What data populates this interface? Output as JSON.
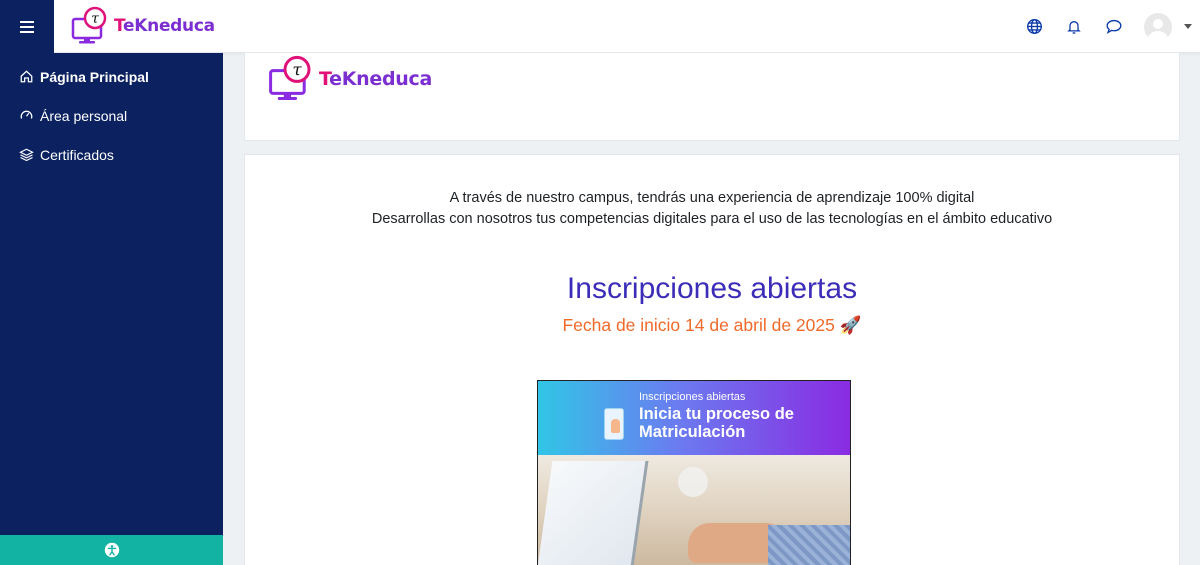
{
  "brand": {
    "prefix": "T",
    "name": "eKneduca",
    "logo_letter": "τ"
  },
  "sidebar": {
    "items": [
      {
        "label": "Página Principal",
        "icon": "home-icon",
        "active": true
      },
      {
        "label": "Área personal",
        "icon": "dashboard-icon",
        "active": false
      },
      {
        "label": "Certificados",
        "icon": "layers-icon",
        "active": false
      }
    ],
    "footer_icon": "accessibility-icon"
  },
  "navbar": {
    "icons": [
      "globe-icon",
      "bell-icon",
      "chat-icon"
    ],
    "user_menu_icon": "avatar"
  },
  "main": {
    "intro_line1": "A través de nuestro campus, tendrás una experiencia de aprendizaje 100% digital",
    "intro_line2": "Desarrollas con nosotros tus competencias digitales para el uso de las tecnologías en el ámbito educativo",
    "headline": "Inscripciones abiertas",
    "subheadline": "Fecha de inicio 14 de abril de 2025 🚀"
  },
  "banner": {
    "small": "Inscripciones abiertas",
    "big_line1": "Inicia tu proceso de",
    "big_line2": "Matriculación"
  },
  "colors": {
    "sidebar": "#0b2160",
    "accent_teal": "#12b3a3",
    "headline": "#3c2db8",
    "subheadline": "#f06a2a",
    "brand_purple": "#7c2fd0",
    "brand_pink": "#e0127a"
  }
}
